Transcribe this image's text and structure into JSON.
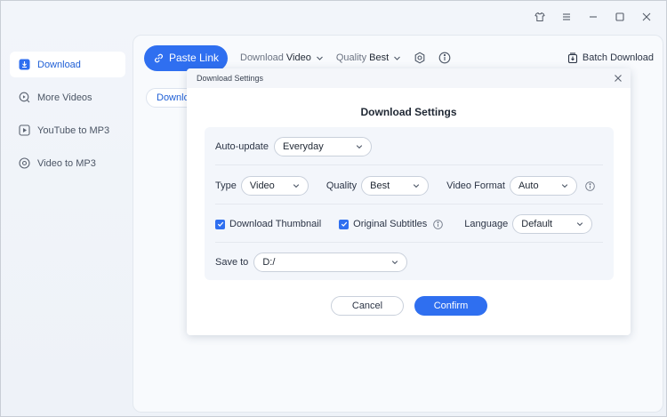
{
  "window": {
    "controls": [
      "shirt-icon",
      "menu-icon",
      "minimize-icon",
      "maximize-icon",
      "close-icon"
    ]
  },
  "sidebar": {
    "items": [
      {
        "label": "Download",
        "icon": "download-icon",
        "active": true
      },
      {
        "label": "More Videos",
        "icon": "search-video-icon",
        "active": false
      },
      {
        "label": "YouTube to MP3",
        "icon": "play-icon",
        "active": false
      },
      {
        "label": "Video to MP3",
        "icon": "convert-icon",
        "active": false
      }
    ]
  },
  "toolbar": {
    "paste_label": "Paste Link",
    "download_prefix": "Download",
    "download_value": "Video",
    "quality_prefix": "Quality",
    "quality_value": "Best",
    "batch_label": "Batch Download"
  },
  "behind": {
    "chip_label": "Download"
  },
  "dialog": {
    "window_title": "Download Settings",
    "heading": "Download Settings",
    "auto_update_label": "Auto-update",
    "auto_update_value": "Everyday",
    "type_label": "Type",
    "type_value": "Video",
    "quality_label": "Quality",
    "quality_value": "Best",
    "format_label": "Video Format",
    "format_value": "Auto",
    "thumbnail_label": "Download Thumbnail",
    "thumbnail_checked": true,
    "subtitles_label": "Original Subtitles",
    "subtitles_checked": true,
    "language_label": "Language",
    "language_value": "Default",
    "save_label": "Save to",
    "save_value": "D:/",
    "cancel_label": "Cancel",
    "confirm_label": "Confirm"
  },
  "colors": {
    "accent": "#2f6ff0",
    "active_text": "#1f5fd6"
  }
}
